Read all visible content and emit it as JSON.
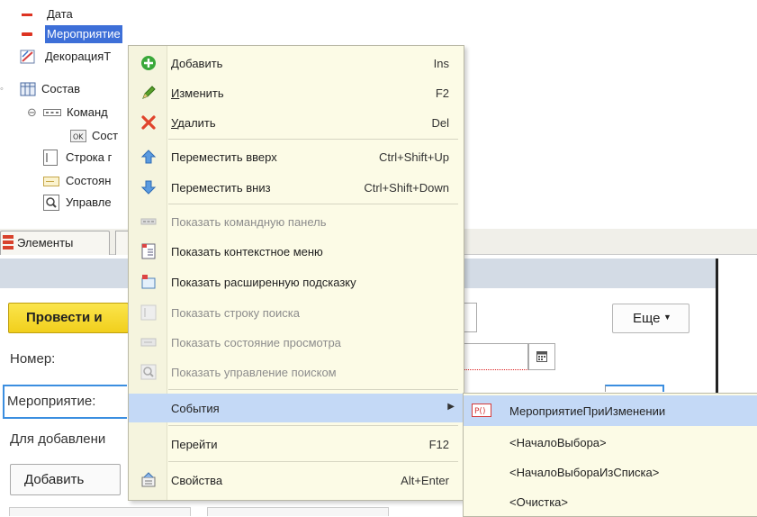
{
  "tree": {
    "items": [
      {
        "label": "Дата"
      },
      {
        "label": "Мероприятие"
      },
      {
        "label": "ДекорацияТ"
      },
      {
        "label": "Состав"
      },
      {
        "label": "Команд"
      },
      {
        "label": "Сост"
      },
      {
        "label": "Строка г"
      },
      {
        "label": "Состоян"
      },
      {
        "label": "Управле"
      }
    ]
  },
  "tabs": {
    "elements_label": "Элементы"
  },
  "form": {
    "post_button": "Провести и",
    "more_button": "Еще",
    "number_label": "Номер:",
    "event_label": "Мероприятие:",
    "add_hint": "Для добавлени",
    "add_button": "Добавить"
  },
  "context_menu": {
    "add": {
      "pre": "",
      "u": "Д",
      "post": "обавить",
      "shortcut": "Ins"
    },
    "edit": {
      "pre": "",
      "u": "И",
      "post": "зменить",
      "shortcut": "F2"
    },
    "delete": {
      "pre": "",
      "u": "У",
      "post": "далить",
      "shortcut": "Del"
    },
    "move_up": {
      "label": "Переместить вверх",
      "shortcut": "Ctrl+Shift+Up"
    },
    "move_down": {
      "label": "Переместить вниз",
      "shortcut": "Ctrl+Shift+Down"
    },
    "show_command_bar": "Показать командную панель",
    "show_context_menu": "Показать контекстное меню",
    "show_ext_tooltip": "Показать расширенную подсказку",
    "show_search_string": "Показать строку поиска",
    "show_view_status": "Показать состояние просмотра",
    "show_search_control": "Показать управление поиском",
    "events": "События",
    "goto": {
      "label": "Перейти",
      "shortcut": "F12"
    },
    "properties": {
      "label": "Свойства",
      "shortcut": "Alt+Enter"
    }
  },
  "submenu": {
    "items": [
      {
        "label": "МероприятиеПриИзменении"
      },
      {
        "label": "<НачалоВыбора>"
      },
      {
        "label": "<НачалоВыбораИзСписка>"
      },
      {
        "label": "<Очистка>"
      }
    ]
  },
  "colors": {
    "selection": "#3d6fd8",
    "menu_bg": "#fcfbe6",
    "menu_highlight": "#c4d9f6",
    "post_button": "#f5d52a"
  }
}
